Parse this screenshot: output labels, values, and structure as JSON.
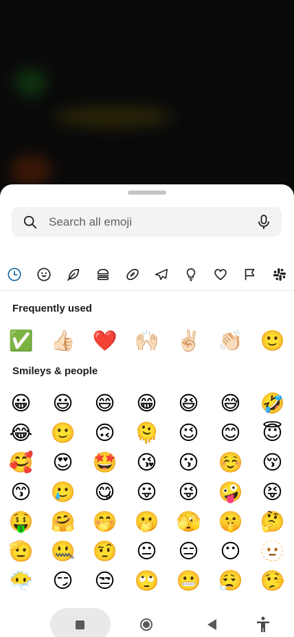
{
  "search": {
    "placeholder": "Search all emoji"
  },
  "categories": [
    {
      "icon": "clock-icon",
      "active": true
    },
    {
      "icon": "smiley-icon"
    },
    {
      "icon": "leaf-icon"
    },
    {
      "icon": "burger-icon"
    },
    {
      "icon": "football-icon"
    },
    {
      "icon": "airplane-icon"
    },
    {
      "icon": "lightbulb-icon"
    },
    {
      "icon": "heart-icon"
    },
    {
      "icon": "flag-icon"
    },
    {
      "icon": "slack-icon"
    }
  ],
  "sections": {
    "frequent": {
      "title": "Frequently used",
      "emoji": [
        "✅",
        "👍🏻",
        "❤️",
        "🙌🏻",
        "✌🏻",
        "👏🏻",
        "🙂"
      ]
    },
    "smileys": {
      "title": "Smileys & people",
      "rows": [
        [
          "😀",
          "😃",
          "😄",
          "😁",
          "😆",
          "😅",
          "🤣"
        ],
        [
          "😂",
          "🙂",
          "🙃",
          "🫠",
          "😉",
          "😊",
          "😇"
        ],
        [
          "🥰",
          "😍",
          "🤩",
          "😘",
          "😗",
          "☺️",
          "😚"
        ],
        [
          "😙",
          "🥲",
          "😋",
          "😛",
          "😜",
          "🤪",
          "😝"
        ],
        [
          "🤑",
          "🤗",
          "🤭",
          "🫢",
          "🫣",
          "🤫",
          "🤔"
        ],
        [
          "🫡",
          "🤐",
          "🤨",
          "😐",
          "😑",
          "😶",
          "🫥"
        ],
        [
          "😶‍🌫️",
          "😏",
          "😒",
          "🙄",
          "😬",
          "😮‍💨",
          "🤥"
        ]
      ]
    }
  },
  "colors": {
    "accent": "#1264a3",
    "sheet": "#ffffff",
    "search_bg": "#f3f3f4"
  }
}
